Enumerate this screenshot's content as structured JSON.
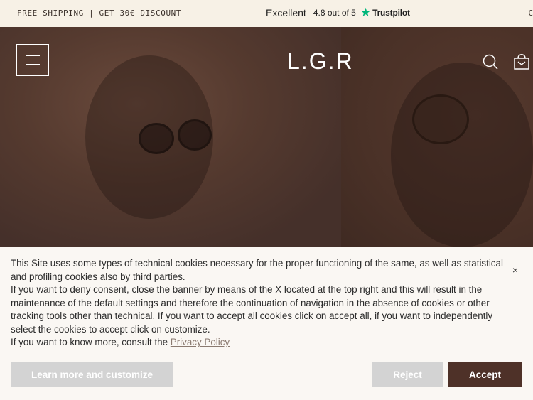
{
  "topbar": {
    "promo": "FREE SHIPPING | GET 30€ DISCOUNT",
    "rating_label": "Excellent",
    "rating_score": "4.8 out of 5",
    "rating_brand": "Trustpilot",
    "overflow_text": "C"
  },
  "header": {
    "logo": "L.G.R",
    "menu_icon": "hamburger-icon",
    "search_icon": "search-icon",
    "bag_icon": "shopping-bag-icon"
  },
  "cookie_banner": {
    "paragraph_1": "This Site uses some types of technical cookies necessary for the proper functioning of the same, as well as statistical and profiling cookies also by third parties.",
    "paragraph_2": "If you want to deny consent, close the banner by means of the X located at the top right and this will result in the maintenance of the default settings and therefore the continuation of navigation in the absence of cookies or other tracking tools other than technical. If you want to accept all cookies click on accept all, if you want to independently select the cookies to accept click on customize.",
    "paragraph_3_prefix": "If you want to know more, consult the ",
    "privacy_link": "Privacy Policy",
    "close_label": "×",
    "learn_more_label": "Learn more and customize",
    "reject_label": "Reject",
    "accept_label": "Accept"
  },
  "colors": {
    "accent": "#4e3128",
    "topbar_bg": "#f7f1e6",
    "trustpilot_star": "#00b67a",
    "button_grey": "#d3d3d3"
  }
}
